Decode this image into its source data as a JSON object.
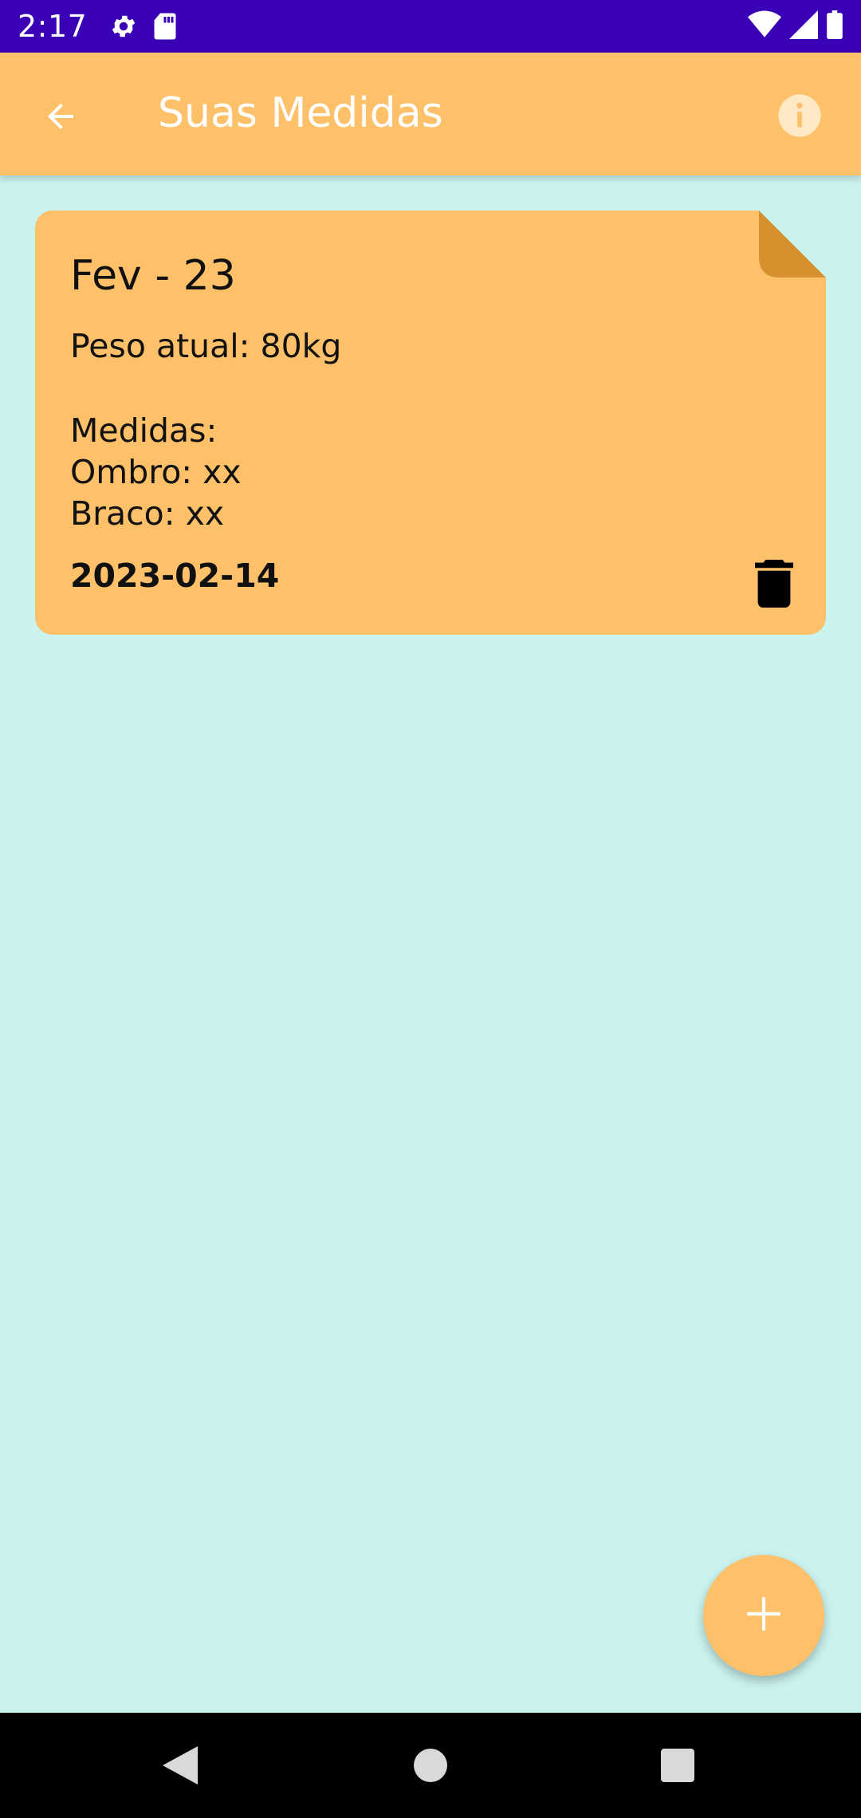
{
  "status_bar": {
    "time": "2:17",
    "icons": [
      "gear-icon",
      "sd-card-icon",
      "wifi-icon",
      "signal-icon",
      "battery-icon"
    ]
  },
  "app_bar": {
    "title": "Suas Medidas",
    "back_icon": "arrow-back-icon",
    "info_icon": "info-icon"
  },
  "note": {
    "title": "Fev - 23",
    "weight": "Peso atual: 80kg",
    "measures_label": "Medidas:",
    "lines": [
      "Ombro: xx",
      "Braco: xx"
    ],
    "date": "2023-02-14",
    "delete_icon": "trash-icon"
  },
  "fab": {
    "icon": "plus-icon"
  },
  "nav": {
    "icons": [
      "nav-back-icon",
      "nav-home-icon",
      "nav-recents-icon"
    ]
  },
  "colors": {
    "status_bar": "#3a00b5",
    "accent": "#ffc06a",
    "fold": "#d6902e",
    "background": "#caf2ee"
  }
}
